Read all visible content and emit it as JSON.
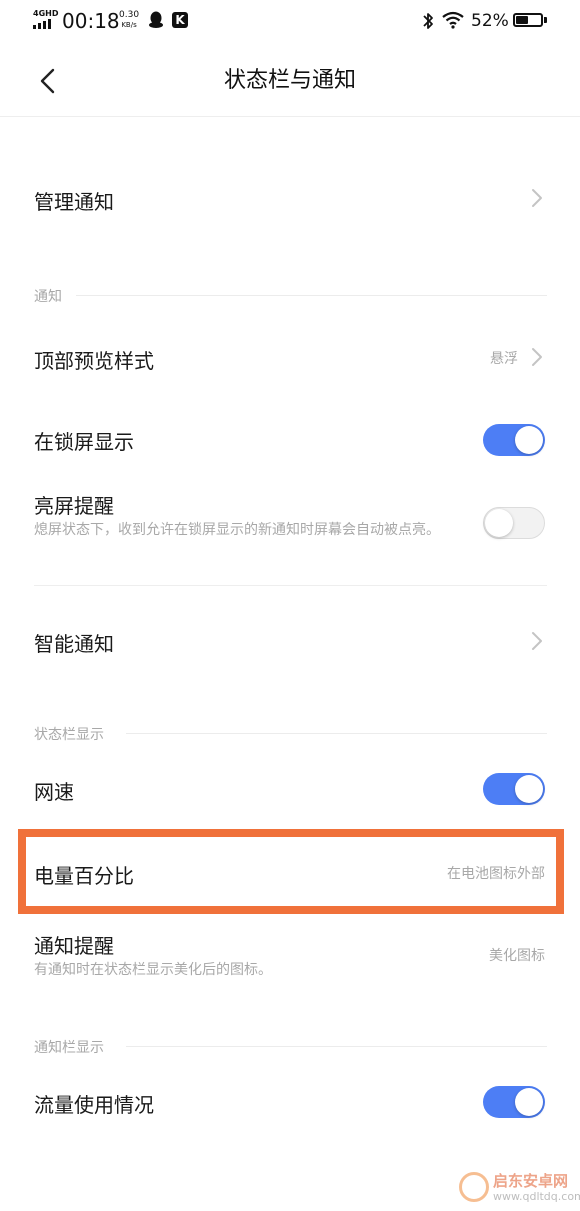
{
  "status_bar": {
    "network": "4GHD",
    "time": "00:18",
    "speed_value": "0.30",
    "speed_unit": "KB/s",
    "app_badge": "K",
    "battery_percent": "52%",
    "battery_level": 0.52,
    "icons": [
      "signal-icon",
      "qq-penguin-icon",
      "k-app-icon",
      "bluetooth-icon",
      "wifi-icon",
      "battery-icon"
    ]
  },
  "header": {
    "title": "状态栏与通知",
    "back_icon": "chevron-left-icon"
  },
  "rows": {
    "manage": {
      "label": "管理通知"
    },
    "preview": {
      "label": "顶部预览样式",
      "value": "悬浮"
    },
    "lockscreen": {
      "label": "在锁屏显示",
      "toggle": true
    },
    "wake": {
      "label": "亮屏提醒",
      "desc": "熄屏状态下，收到允许在锁屏显示的新通知时屏幕会自动被点亮。",
      "toggle": false
    },
    "smart": {
      "label": "智能通知"
    },
    "speed": {
      "label": "网速",
      "toggle": true
    },
    "battery": {
      "label": "电量百分比",
      "value": "在电池图标外部"
    },
    "notify_hint": {
      "label": "通知提醒",
      "desc": "有通知时在状态栏显示美化后的图标。",
      "value": "美化图标"
    },
    "data_usage": {
      "label": "流量使用情况",
      "toggle": true
    }
  },
  "sections": {
    "notification": "通知",
    "statusbar": "状态栏显示",
    "notifbar": "通知栏显示"
  },
  "colors": {
    "toggle_on": "#4d7ef5",
    "highlight_border": "#f0713a"
  },
  "watermark": {
    "brand": "启东安卓网",
    "url": "www.qdltdq.com"
  }
}
